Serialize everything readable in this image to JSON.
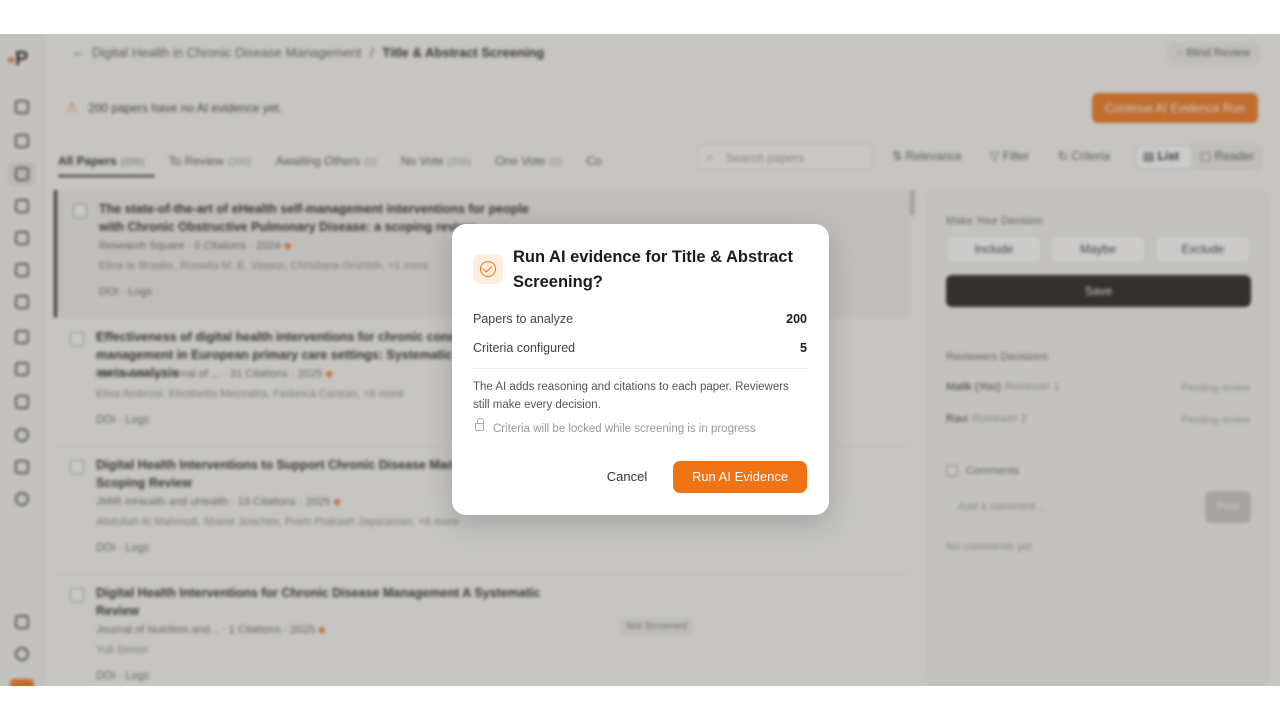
{
  "app": {
    "logo_text": "P",
    "brand_color": "#f07416"
  },
  "sidebar": {
    "icons": [
      "home-icon",
      "folder-icon",
      "document-icon",
      "file-icon",
      "box-icon",
      "grid-icon",
      "gear-icon",
      "table-icon",
      "list-icon",
      "page-icon",
      "search-icon",
      "chat-icon",
      "history-icon",
      "calendar-icon",
      "help-icon"
    ]
  },
  "header": {
    "breadcrumb_parent": "Digital Health in Chronic Disease Management",
    "breadcrumb_sep": "/",
    "breadcrumb_current": "Title & Abstract Screening",
    "blind_review": "Blind Review"
  },
  "banner": {
    "text": "200 papers have no AI evidence yet.",
    "button": "Continue AI Evidence Run"
  },
  "tabs": [
    {
      "label": "All Papers",
      "count": "(200)"
    },
    {
      "label": "To Review",
      "count": "(200)"
    },
    {
      "label": "Awaiting Others",
      "count": "(0)"
    },
    {
      "label": "No Vote",
      "count": "(200)"
    },
    {
      "label": "One Vote",
      "count": "(0)"
    },
    {
      "label": "Co",
      "count": ""
    }
  ],
  "toolbar": {
    "search_placeholder": "Search papers",
    "relevance": "Relevance",
    "filter": "Filter",
    "criteria": "Criteria",
    "list": "List",
    "reader": "Reader"
  },
  "papers": [
    {
      "title": "The state-of-the-art of eHealth self-management interventions for people with Chronic Obstructive Pulmonary Disease: a scoping review",
      "meta": "Research Square   ·   0 Citations   ·   2024",
      "authors": "Eline te Braake, Roswita M. E. Vaseur, Christiane Grünloh, +1 more",
      "links": "DOI   ·   Logs"
    },
    {
      "title": "Effectiveness of digital health interventions for chronic conditions management in European primary care settings: Systematic review and meta-analysis",
      "meta": "International Journal of ...   ·   31 Citations   ·   2025",
      "authors": "Elisa Ambrosi, Elisabetta Mezzalira, Federica Canzan, +6 more",
      "links": "DOI   ·   Logs"
    },
    {
      "title": "Digital Health Interventions to Support Chronic Disease Management: A Scoping Review",
      "meta": "JMIR mHealth and uHealth   ·   19 Citations   ·   2025",
      "authors": "Abdullah Al Mahmud, Shane Joachim, Prem Prakash Jayaraman, +6 more",
      "links": "DOI   ·   Logs"
    },
    {
      "title": "Digital Health Interventions for Chronic Disease Management A Systematic Review",
      "meta": "Journal of Nutrition and...   ·   1 Citations   ·   2025",
      "authors": "Yuli Simon",
      "links": "DOI   ·   Logs"
    }
  ],
  "badge_not_screened": "Not Screened",
  "decision_panel": {
    "heading": "Make Your Decision",
    "include": "Include",
    "maybe": "Maybe",
    "exclude": "Exclude",
    "save": "Save",
    "reviewers_heading": "Reviewers Decisions",
    "reviewers": [
      {
        "name": "Malik (You)",
        "role": "Reviewer 1",
        "status": "Pending review"
      },
      {
        "name": "Ravi",
        "role": "Reviewer 2",
        "status": "Pending review"
      }
    ],
    "comments_label": "Comments",
    "comment_placeholder": "Add a comment...",
    "post": "Post",
    "no_comments": "No comments yet"
  },
  "modal": {
    "title": "Run AI evidence for Title & Abstract Screening?",
    "papers_label": "Papers to analyze",
    "papers_value": "200",
    "criteria_label": "Criteria configured",
    "criteria_value": "5",
    "description": "The AI adds reasoning and citations to each paper. Reviewers still make every decision.",
    "lock_note": "Criteria will be locked while screening is in progress",
    "cancel": "Cancel",
    "run": "Run AI Evidence"
  }
}
